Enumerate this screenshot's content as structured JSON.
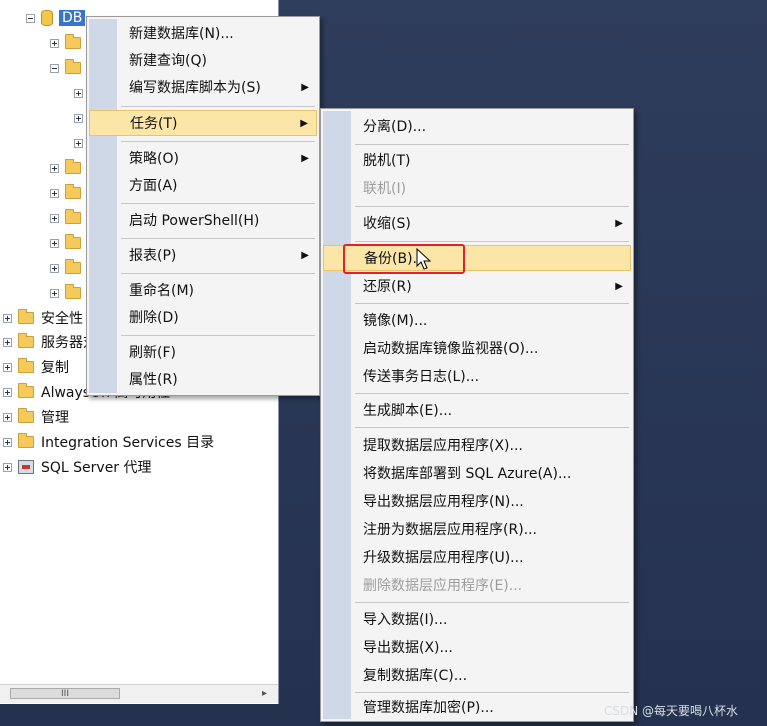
{
  "explorer": {
    "db_label": "DB",
    "nodes": [
      {
        "label": "安全性"
      },
      {
        "label": "服务器对象"
      },
      {
        "label": "复制"
      },
      {
        "label": "AlwaysOn 高可用性"
      },
      {
        "label": "管理"
      },
      {
        "label": "Integration Services 目录"
      },
      {
        "label": "SQL Server 代理"
      }
    ],
    "scroll_thumb": "III",
    "scroll_right": "▸"
  },
  "context_menu": {
    "items": [
      {
        "label": "新建数据库(N)..."
      },
      {
        "label": "新建查询(Q)"
      },
      {
        "label": "编写数据库脚本为(S)",
        "arrow": "▶"
      },
      {
        "label": "任务(T)",
        "arrow": "▶"
      },
      {
        "label": "策略(O)",
        "arrow": "▶"
      },
      {
        "label": "方面(A)"
      },
      {
        "label": "启动 PowerShell(H)"
      },
      {
        "label": "报表(P)",
        "arrow": "▶"
      },
      {
        "label": "重命名(M)"
      },
      {
        "label": "删除(D)"
      },
      {
        "label": "刷新(F)"
      },
      {
        "label": "属性(R)"
      }
    ]
  },
  "tasks_menu": {
    "items": [
      {
        "label": "分离(D)..."
      },
      {
        "label": "脱机(T)"
      },
      {
        "label": "联机(I)"
      },
      {
        "label": "收缩(S)",
        "arrow": "▶"
      },
      {
        "label": "备份(B)..."
      },
      {
        "label": "还原(R)",
        "arrow": "▶"
      },
      {
        "label": "镜像(M)..."
      },
      {
        "label": "启动数据库镜像监视器(O)..."
      },
      {
        "label": "传送事务日志(L)..."
      },
      {
        "label": "生成脚本(E)..."
      },
      {
        "label": "提取数据层应用程序(X)..."
      },
      {
        "label": "将数据库部署到 SQL Azure(A)..."
      },
      {
        "label": "导出数据层应用程序(N)..."
      },
      {
        "label": "注册为数据层应用程序(R)..."
      },
      {
        "label": "升级数据层应用程序(U)..."
      },
      {
        "label": "删除数据层应用程序(E)..."
      },
      {
        "label": "导入数据(I)..."
      },
      {
        "label": "导出数据(X)..."
      },
      {
        "label": "复制数据库(C)..."
      },
      {
        "label": "管理数据库加密(P)..."
      }
    ]
  },
  "watermark": "CSDN @每天要喝八杯水",
  "colors": {
    "highlight": "#fbe6a8",
    "annotation_box": "#e0202b",
    "gutter": "#cfd8e6"
  }
}
